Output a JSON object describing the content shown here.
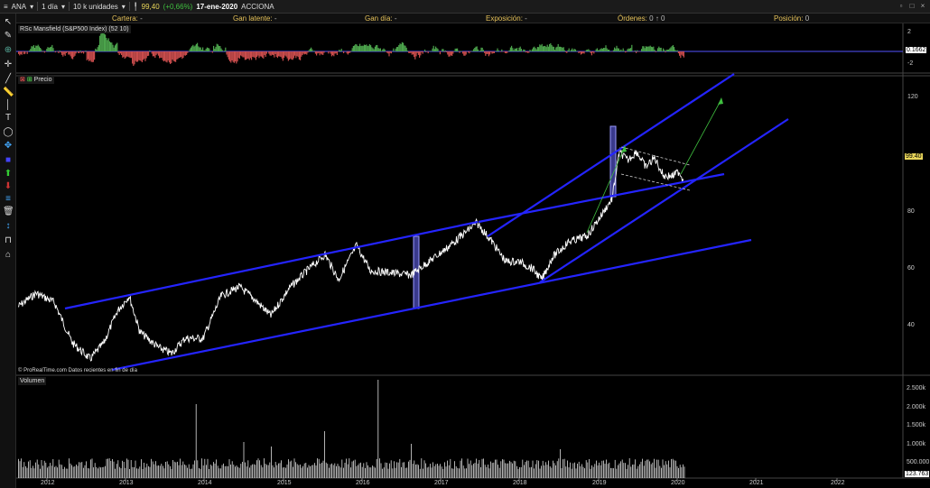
{
  "toolbar_top": {
    "symbol": "ANA",
    "period": "1 día",
    "units": "10 k unidades",
    "price": "99,40",
    "change": "(+0,66%)",
    "date": "17-ene-2020",
    "company": "ACCIONA"
  },
  "infobar": {
    "cartera_label": "Cartera:",
    "cartera_value": "-",
    "gan_latente_label": "Gan latente:",
    "gan_latente_value": "-",
    "gan_dia_label": "Gan día:",
    "gan_dia_value": "-",
    "exposicion_label": "Exposición:",
    "exposicion_value": "-",
    "ordenes_label": "Órdenes:",
    "ordenes_value": "0 ↑  0",
    "posicion_label": "Posición:",
    "posicion_value": "0"
  },
  "indicator_panel": {
    "label": "RSc Mansfield (S&P500 Index) (52 10)",
    "current_value": "0.1662",
    "axis_ticks": [
      "2",
      "0",
      "-2"
    ]
  },
  "price_panel": {
    "label": "Precio",
    "current_price": "99.40",
    "axis_ticks": [
      "120",
      "100",
      "80",
      "60",
      "40"
    ],
    "footnote": "© ProRealTime.com  Datos recientes en fin de día"
  },
  "volume_panel": {
    "label": "Volumen",
    "current_value": "123.763",
    "axis_ticks": [
      "2.500k",
      "2.000k",
      "1.500k",
      "1.000k",
      "500.000"
    ]
  },
  "x_axis": {
    "years": [
      "2012",
      "2013",
      "2014",
      "2015",
      "2016",
      "2017",
      "2018",
      "2019",
      "2020",
      "2021",
      "2022"
    ]
  },
  "colors": {
    "background": "#000000",
    "price_line": "#ffffff",
    "trendlines": "#2424ff",
    "highlight": "#6a6aff",
    "rsc_positive": "#4ca44c",
    "rsc_negative": "#c94c4c",
    "projection": "#3fbf3f",
    "price_tag": "#e8d55a"
  }
}
